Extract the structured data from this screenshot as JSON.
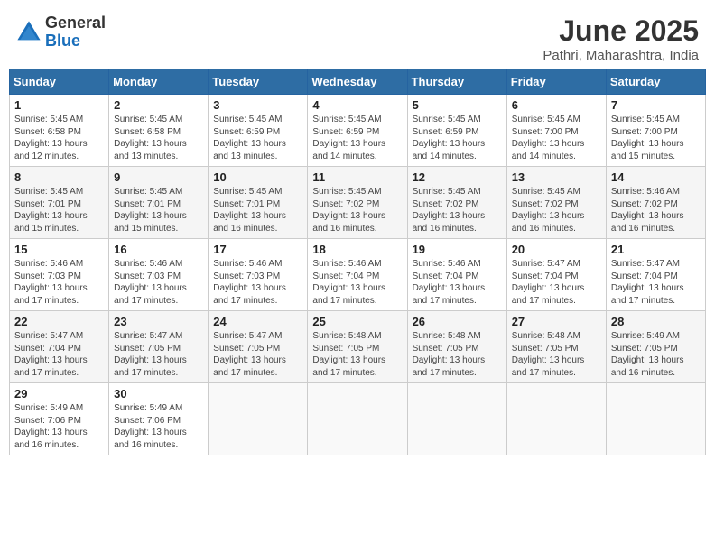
{
  "logo": {
    "general": "General",
    "blue": "Blue"
  },
  "title": {
    "month_year": "June 2025",
    "location": "Pathri, Maharashtra, India"
  },
  "headers": [
    "Sunday",
    "Monday",
    "Tuesday",
    "Wednesday",
    "Thursday",
    "Friday",
    "Saturday"
  ],
  "weeks": [
    [
      {
        "day": "1",
        "sunrise": "5:45 AM",
        "sunset": "6:58 PM",
        "daylight": "13 hours and 12 minutes."
      },
      {
        "day": "2",
        "sunrise": "5:45 AM",
        "sunset": "6:58 PM",
        "daylight": "13 hours and 13 minutes."
      },
      {
        "day": "3",
        "sunrise": "5:45 AM",
        "sunset": "6:59 PM",
        "daylight": "13 hours and 13 minutes."
      },
      {
        "day": "4",
        "sunrise": "5:45 AM",
        "sunset": "6:59 PM",
        "daylight": "13 hours and 14 minutes."
      },
      {
        "day": "5",
        "sunrise": "5:45 AM",
        "sunset": "6:59 PM",
        "daylight": "13 hours and 14 minutes."
      },
      {
        "day": "6",
        "sunrise": "5:45 AM",
        "sunset": "7:00 PM",
        "daylight": "13 hours and 14 minutes."
      },
      {
        "day": "7",
        "sunrise": "5:45 AM",
        "sunset": "7:00 PM",
        "daylight": "13 hours and 15 minutes."
      }
    ],
    [
      {
        "day": "8",
        "sunrise": "5:45 AM",
        "sunset": "7:01 PM",
        "daylight": "13 hours and 15 minutes."
      },
      {
        "day": "9",
        "sunrise": "5:45 AM",
        "sunset": "7:01 PM",
        "daylight": "13 hours and 15 minutes."
      },
      {
        "day": "10",
        "sunrise": "5:45 AM",
        "sunset": "7:01 PM",
        "daylight": "13 hours and 16 minutes."
      },
      {
        "day": "11",
        "sunrise": "5:45 AM",
        "sunset": "7:02 PM",
        "daylight": "13 hours and 16 minutes."
      },
      {
        "day": "12",
        "sunrise": "5:45 AM",
        "sunset": "7:02 PM",
        "daylight": "13 hours and 16 minutes."
      },
      {
        "day": "13",
        "sunrise": "5:45 AM",
        "sunset": "7:02 PM",
        "daylight": "13 hours and 16 minutes."
      },
      {
        "day": "14",
        "sunrise": "5:46 AM",
        "sunset": "7:02 PM",
        "daylight": "13 hours and 16 minutes."
      }
    ],
    [
      {
        "day": "15",
        "sunrise": "5:46 AM",
        "sunset": "7:03 PM",
        "daylight": "13 hours and 17 minutes."
      },
      {
        "day": "16",
        "sunrise": "5:46 AM",
        "sunset": "7:03 PM",
        "daylight": "13 hours and 17 minutes."
      },
      {
        "day": "17",
        "sunrise": "5:46 AM",
        "sunset": "7:03 PM",
        "daylight": "13 hours and 17 minutes."
      },
      {
        "day": "18",
        "sunrise": "5:46 AM",
        "sunset": "7:04 PM",
        "daylight": "13 hours and 17 minutes."
      },
      {
        "day": "19",
        "sunrise": "5:46 AM",
        "sunset": "7:04 PM",
        "daylight": "13 hours and 17 minutes."
      },
      {
        "day": "20",
        "sunrise": "5:47 AM",
        "sunset": "7:04 PM",
        "daylight": "13 hours and 17 minutes."
      },
      {
        "day": "21",
        "sunrise": "5:47 AM",
        "sunset": "7:04 PM",
        "daylight": "13 hours and 17 minutes."
      }
    ],
    [
      {
        "day": "22",
        "sunrise": "5:47 AM",
        "sunset": "7:04 PM",
        "daylight": "13 hours and 17 minutes."
      },
      {
        "day": "23",
        "sunrise": "5:47 AM",
        "sunset": "7:05 PM",
        "daylight": "13 hours and 17 minutes."
      },
      {
        "day": "24",
        "sunrise": "5:47 AM",
        "sunset": "7:05 PM",
        "daylight": "13 hours and 17 minutes."
      },
      {
        "day": "25",
        "sunrise": "5:48 AM",
        "sunset": "7:05 PM",
        "daylight": "13 hours and 17 minutes."
      },
      {
        "day": "26",
        "sunrise": "5:48 AM",
        "sunset": "7:05 PM",
        "daylight": "13 hours and 17 minutes."
      },
      {
        "day": "27",
        "sunrise": "5:48 AM",
        "sunset": "7:05 PM",
        "daylight": "13 hours and 17 minutes."
      },
      {
        "day": "28",
        "sunrise": "5:49 AM",
        "sunset": "7:05 PM",
        "daylight": "13 hours and 16 minutes."
      }
    ],
    [
      {
        "day": "29",
        "sunrise": "5:49 AM",
        "sunset": "7:06 PM",
        "daylight": "13 hours and 16 minutes."
      },
      {
        "day": "30",
        "sunrise": "5:49 AM",
        "sunset": "7:06 PM",
        "daylight": "13 hours and 16 minutes."
      },
      null,
      null,
      null,
      null,
      null
    ]
  ],
  "labels": {
    "sunrise": "Sunrise:",
    "sunset": "Sunset:",
    "daylight": "Daylight:"
  }
}
